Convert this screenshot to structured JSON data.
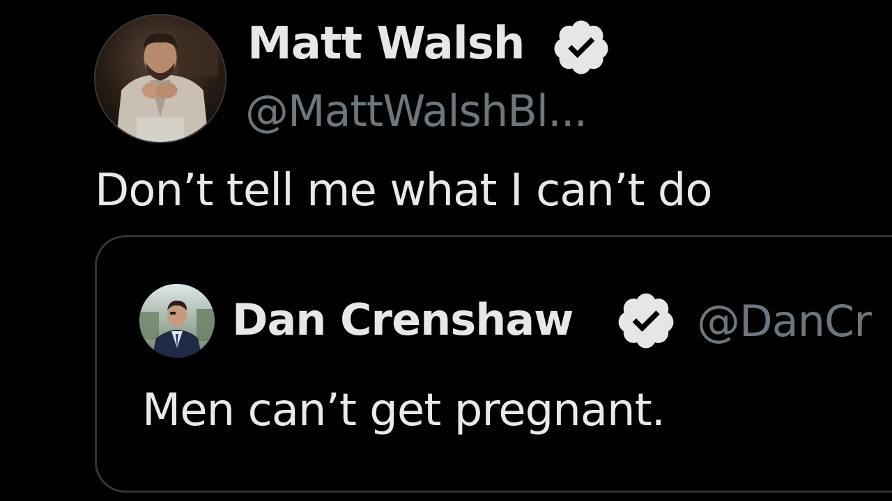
{
  "colors": {
    "background": "#000000",
    "name_text": "#e7e7e7",
    "body_text": "#e7e9ea",
    "handle_text": "#6e767d",
    "card_border": "#333639",
    "badge_fill": "#e6e6e6",
    "badge_check": "#000000"
  },
  "tweet": {
    "author": {
      "name": "Matt Walsh",
      "handle": "@MattWalshBl...",
      "avatar_icon": "avatar-photo-icon",
      "badge_icon": "verified-badge-icon"
    },
    "text": "Don’t tell me what I can’t do",
    "quoted": {
      "author": {
        "name": "Dan Crenshaw",
        "handle": "@DanCr",
        "avatar_icon": "avatar-photo-icon",
        "badge_icon": "verified-badge-icon"
      },
      "text": "Men can’t get pregnant."
    }
  }
}
